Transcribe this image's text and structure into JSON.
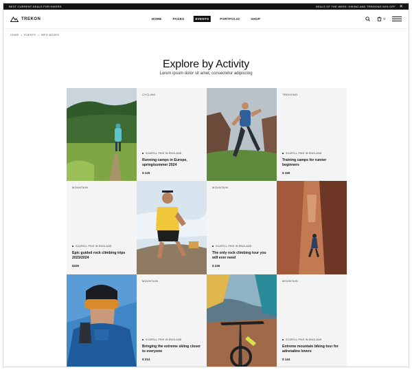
{
  "topbar": {
    "left": "BEST CURRENT DEALS FOR HIKERS",
    "right": "DEALS OF THE WEEK: HIKING AND TREKKING 50% OFF"
  },
  "nav": {
    "brand": "TREKON",
    "menu": [
      "HOME",
      "PAGES",
      "EVENTS",
      "PORTFOLIO",
      "SHOP"
    ],
    "active": "EVENTS",
    "cart_count": "0"
  },
  "breadcrumb": [
    "HOME",
    "EVENTS",
    "INFO BOXES"
  ],
  "hero": {
    "title": "Explore by Activity",
    "subtitle": "Lorem ipsum dolor sit amet, consectetur adipiscing"
  },
  "cards": [
    {
      "tag": "CYCLING",
      "location": "SCAFELL PIKE IN ENGLAND",
      "title": "Running camps in Europe, spring/summer 2024",
      "price": "$ 120"
    },
    {
      "tag": "TREKKING",
      "location": "SCAFELL PIKE IN ENGLAND",
      "title": "Training camps for runner beginners",
      "price": "$ 150"
    },
    {
      "tag": "MOUNTAIN",
      "location": "SCAFELL PIKE IN ENGLAND",
      "title": "Epic guided rock climbing trips 2023/2024",
      "price": "$226"
    },
    {
      "tag": "MOUNTAIN",
      "location": "SCAFELL PIKE IN ENGLAND",
      "title": "The only rock climbing tour you will ever need",
      "price": "$ 226"
    },
    {
      "tag": "MOUNTAIN",
      "location": "SCAFELL PIKE IN ENGLAND",
      "title": "Bringing the extreme skiing closer to everyone",
      "price": "$ 214"
    },
    {
      "tag": "MOUNTAIN",
      "location": "SCAFELL PIKE IN ENGLAND",
      "title": "Extreme mountain biking tour for adrenaline lovers",
      "price": "$ 144"
    }
  ],
  "icons": {
    "logo": "mountain-logo-icon",
    "search": "search-icon",
    "cart": "cart-icon",
    "menu": "hamburger-menu-icon",
    "close": "close-icon"
  },
  "colors": {
    "topbar": "#151515",
    "card_bg": "#f4f4f4",
    "text": "#111111"
  }
}
